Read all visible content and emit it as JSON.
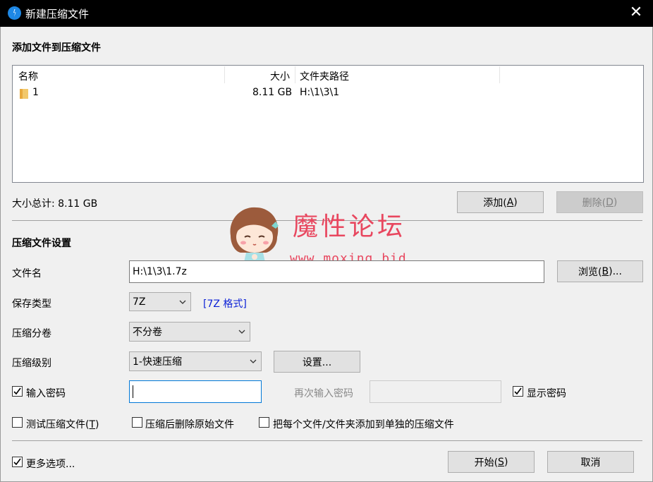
{
  "window": {
    "title": "新建压缩文件",
    "close_glyph": "✕"
  },
  "add_section": {
    "heading": "添加文件到压缩文件"
  },
  "file_list": {
    "columns": {
      "name": "名称",
      "size": "大小",
      "path": "文件夹路径"
    },
    "rows": [
      {
        "name": "1",
        "size": "8.11 GB",
        "path": "H:\\1\\3\\1"
      }
    ]
  },
  "total": {
    "label": "大小总计: 8.11 GB"
  },
  "buttons": {
    "add": {
      "text": "添加(",
      "key": "A",
      "end": ")"
    },
    "delete": {
      "text": "删除(",
      "key": "D",
      "end": ")"
    },
    "browse": {
      "text": "浏览(",
      "key": "B",
      "end": ")..."
    },
    "settings": "设置...",
    "start": {
      "text": "开始(",
      "key": "S",
      "end": ")"
    },
    "cancel": "取消"
  },
  "settings_section": {
    "heading": "压缩文件设置"
  },
  "fields": {
    "filename": {
      "label": "文件名",
      "value": "H:\\1\\3\\1.7z"
    },
    "save_type": {
      "label": "保存类型",
      "value": "7Z",
      "link": "[7Z 格式]"
    },
    "volume": {
      "label": "压缩分卷",
      "value": "不分卷"
    },
    "level": {
      "label": "压缩级别",
      "value": "1-快速压缩"
    },
    "password": {
      "label": "输入密码",
      "checked": true,
      "value": ""
    },
    "password_confirm": {
      "label": "再次输入密码",
      "value": ""
    },
    "show_password": {
      "label": "显示密码",
      "checked": true
    }
  },
  "options": {
    "test": {
      "text": "测试压缩文件(",
      "key": "T",
      "end": ")",
      "checked": false
    },
    "delete_after": {
      "label": "压缩后删除原始文件",
      "checked": false
    },
    "each_separate": {
      "label": "把每个文件/文件夹添加到单独的压缩文件",
      "checked": false
    },
    "more": {
      "label": "更多选项...",
      "checked": true
    }
  },
  "watermark": {
    "text": "魔性论坛",
    "url": "www.moxing.bid"
  },
  "colors": {
    "title_bar": "#000000",
    "accent": "#0078d7",
    "link": "#0a1fd6",
    "watermark": "#e8475f"
  }
}
